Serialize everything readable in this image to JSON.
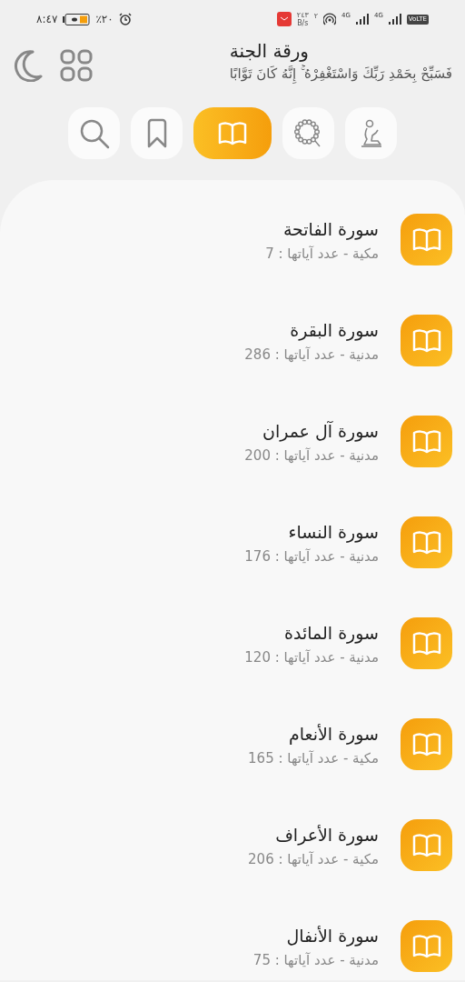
{
  "status_bar": {
    "time": "٨:٤٧",
    "battery": "٪٢٠",
    "speed": "٢٤٣",
    "speed_unit": "B/s",
    "speed_sup": "٢",
    "networks": [
      "4G",
      "4G"
    ],
    "volte": "VoLTE"
  },
  "header": {
    "title": "ورقة الجنة",
    "subtitle": "فَسَبِّحْ بِحَمْدِ رَبِّكَ وَاسْتَغْفِرْهُ ۚ إِنَّهُ كَانَ تَوَّابًا"
  },
  "tabs": [
    {
      "kind": "prayer",
      "selected": false
    },
    {
      "kind": "tasbih",
      "selected": false
    },
    {
      "kind": "quran",
      "selected": true
    },
    {
      "kind": "bookmark",
      "selected": false
    },
    {
      "kind": "search",
      "selected": false
    }
  ],
  "surahs": [
    {
      "name": "سورة الفاتحة",
      "info": "مكية - عدد آياتها : 7"
    },
    {
      "name": "سورة البقرة",
      "info": "مدنية - عدد آياتها : 286"
    },
    {
      "name": "سورة آل عمران",
      "info": "مدنية - عدد آياتها : 200"
    },
    {
      "name": "سورة النساء",
      "info": "مدنية - عدد آياتها : 176"
    },
    {
      "name": "سورة المائدة",
      "info": "مدنية - عدد آياتها : 120"
    },
    {
      "name": "سورة الأنعام",
      "info": "مكية - عدد آياتها : 165"
    },
    {
      "name": "سورة الأعراف",
      "info": "مكية - عدد آياتها : 206"
    },
    {
      "name": "سورة الأنفال",
      "info": "مدنية - عدد آياتها : 75"
    }
  ]
}
